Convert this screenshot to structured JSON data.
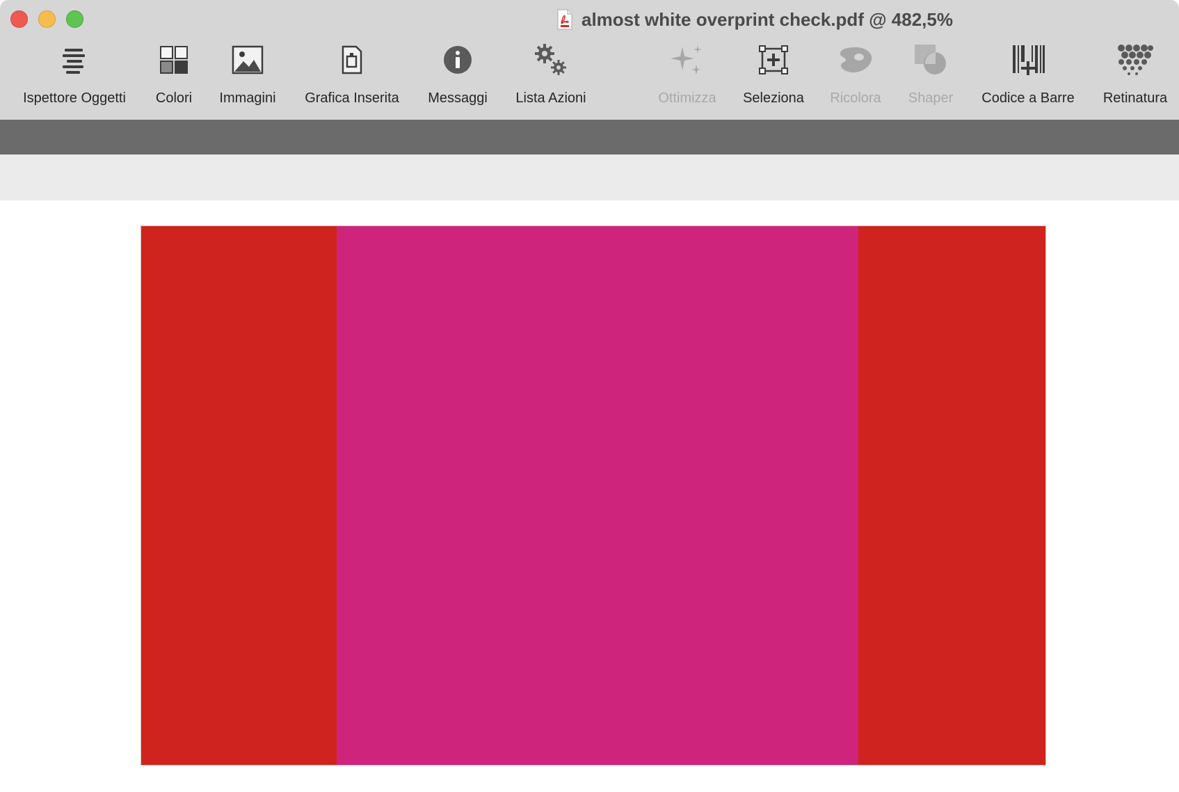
{
  "window": {
    "title": "almost white overprint check.pdf @ 482,5%",
    "document_icon": "pdf-file-icon"
  },
  "toolbar": {
    "items": [
      {
        "id": "object-inspector",
        "label": "Ispettore Oggetti",
        "icon": "object-inspector-icon",
        "enabled": true
      },
      {
        "id": "colors",
        "label": "Colori",
        "icon": "colors-icon",
        "enabled": true
      },
      {
        "id": "images",
        "label": "Immagini",
        "icon": "images-icon",
        "enabled": true
      },
      {
        "id": "placed-graphics",
        "label": "Grafica Inserita",
        "icon": "placed-graphic-icon",
        "enabled": true
      },
      {
        "id": "messages",
        "label": "Messaggi",
        "icon": "info-icon",
        "enabled": true
      },
      {
        "id": "action-list",
        "label": "Lista Azioni",
        "icon": "gears-icon",
        "enabled": true
      },
      {
        "id": "optimize",
        "label": "Ottimizza",
        "icon": "sparkles-icon",
        "enabled": false
      },
      {
        "id": "select",
        "label": "Seleziona",
        "icon": "select-icon",
        "enabled": true
      },
      {
        "id": "recolor",
        "label": "Ricolora",
        "icon": "palette-icon",
        "enabled": false
      },
      {
        "id": "shaper",
        "label": "Shaper",
        "icon": "shaper-icon",
        "enabled": false
      },
      {
        "id": "barcode",
        "label": "Codice a Barre",
        "icon": "barcode-icon",
        "enabled": true
      },
      {
        "id": "screening",
        "label": "Retinatura",
        "icon": "halftone-icon",
        "enabled": true
      }
    ]
  },
  "document": {
    "bands": [
      {
        "color": "#cf231d",
        "fraction": 0.216
      },
      {
        "color": "#cf247b",
        "fraction": 0.577
      },
      {
        "color": "#cf231d",
        "fraction": 0.207
      }
    ]
  },
  "colors": {
    "titlebar_bg": "#d6d6d6",
    "darkbar_bg": "#6b6b6b",
    "lightbar_bg": "#ebebeb"
  }
}
